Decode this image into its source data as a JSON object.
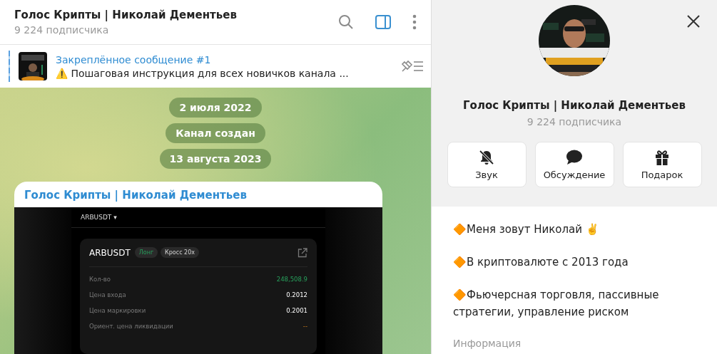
{
  "chat_header": {
    "title": "Голос Крипты | Николай Дементьев",
    "subtitle": "9 224 подписчика",
    "sidebar_toggle_on": true
  },
  "pinned": {
    "title": "Закреплённое сообщение #1",
    "text": "⚠️ Пошаговая инструкция для всех новичков канала ..."
  },
  "service_messages": [
    {
      "text": "2 июля 2022"
    },
    {
      "text": "Канал создан"
    },
    {
      "text": "13 августа 2023"
    }
  ],
  "message": {
    "author": "Голос Крипты | Николай Дементьев",
    "screenshot": {
      "symbol_menu": "ARBUSDT ▾",
      "card_title": "ARBUSDT",
      "tags": [
        {
          "text": "Лонг",
          "kind": "side"
        },
        {
          "text": "Кросс 20x",
          "kind": "margin"
        }
      ],
      "rows": [
        {
          "label": "Кол-во",
          "value": "248,508.9",
          "kind": "gain"
        },
        {
          "label": "Цена входа",
          "value": "0.2012",
          "kind": "plain"
        },
        {
          "label": "Цена маркировки",
          "value": "0.2001",
          "kind": "plain"
        },
        {
          "label": "Ориент. цена ликвидации",
          "value": "--",
          "kind": "warning"
        }
      ]
    }
  },
  "profile": {
    "name": "Голос Крипты | Николай Дементьев",
    "subtitle": "9 224 подписчика",
    "actions": [
      {
        "kind": "mute",
        "label": "Звук"
      },
      {
        "kind": "discussion",
        "label": "Обсуждение"
      },
      {
        "kind": "gift",
        "label": "Подарок"
      }
    ],
    "about": [
      "🔶Меня зовут Николай ✌️",
      "🔶В криптовалюте с 2013 года",
      "🔶Фьючерсная торговля, пассивные стратегии, управление риском"
    ],
    "about_label": "Информация"
  }
}
